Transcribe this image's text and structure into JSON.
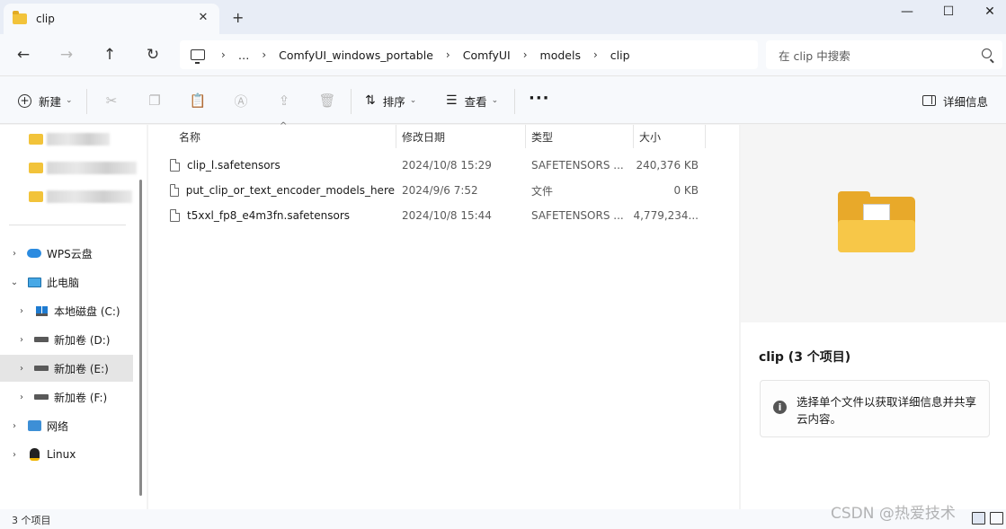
{
  "window": {
    "tab_title": "clip",
    "tab_close": "✕",
    "new_tab": "+",
    "minimize": "—",
    "maximize": "☐",
    "close": "✕"
  },
  "nav": {
    "back": "←",
    "forward": "→",
    "up": "↑",
    "refresh": "↻",
    "breadcrumbs": [
      "…",
      "ComfyUI_windows_portable",
      "ComfyUI",
      "models",
      "clip"
    ],
    "sep": "›",
    "search_placeholder": "在 clip 中搜索"
  },
  "toolbar": {
    "new_label": "新建",
    "sort_label": "排序",
    "view_label": "查看",
    "more": "···",
    "details_label": "详细信息",
    "icons": [
      "cut-icon",
      "copy-icon",
      "paste-icon",
      "rename-icon",
      "share-icon",
      "delete-icon"
    ]
  },
  "sidebar": {
    "items": [
      {
        "label": "WPS云盘",
        "icon": "cloud-icon",
        "chevron": "›"
      },
      {
        "label": "此电脑",
        "icon": "computer-icon",
        "chevron": "⌄"
      },
      {
        "label": "本地磁盘 (C:)",
        "icon": "windows-drive-icon",
        "chevron": "›"
      },
      {
        "label": "新加卷 (D:)",
        "icon": "drive-icon",
        "chevron": "›"
      },
      {
        "label": "新加卷 (E:)",
        "icon": "drive-icon",
        "chevron": "›"
      },
      {
        "label": "新加卷 (F:)",
        "icon": "drive-icon",
        "chevron": "›"
      },
      {
        "label": "网络",
        "icon": "network-icon",
        "chevron": "›"
      },
      {
        "label": "Linux",
        "icon": "linux-icon",
        "chevron": "›"
      }
    ]
  },
  "files": {
    "columns": [
      "名称",
      "修改日期",
      "类型",
      "大小"
    ],
    "sort_indicator": "^",
    "rows": [
      {
        "name": "clip_l.safetensors",
        "date": "2024/10/8 15:29",
        "type": "SAFETENSORS ...",
        "size": "240,376 KB"
      },
      {
        "name": "put_clip_or_text_encoder_models_here",
        "date": "2024/9/6 7:52",
        "type": "文件",
        "size": "0 KB"
      },
      {
        "name": "t5xxl_fp8_e4m3fn.safetensors",
        "date": "2024/10/8 15:44",
        "type": "SAFETENSORS ...",
        "size": "4,779,234..."
      }
    ]
  },
  "preview": {
    "title": "clip (3 个项目)",
    "info_icon": "i",
    "info_text": "选择单个文件以获取详细信息并共享云内容。"
  },
  "status": {
    "count": "3 个项目",
    "watermark": "CSDN @热爱技术"
  }
}
